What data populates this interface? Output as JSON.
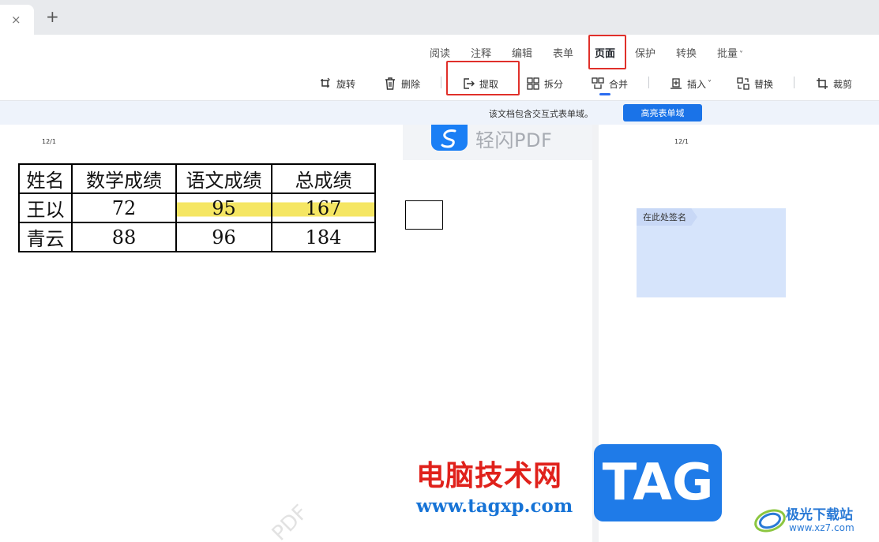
{
  "tabbar": {
    "close_glyph": "×",
    "new_tab_glyph": "+"
  },
  "menu": {
    "tabs": [
      "阅读",
      "注释",
      "编辑",
      "表单",
      "页面",
      "保护",
      "转换",
      "批量"
    ],
    "active": "页面",
    "batch_caret": "˅"
  },
  "toolbar": {
    "rotate": "旋转",
    "delete": "删除",
    "extract": "提取",
    "split": "拆分",
    "merge": "合并",
    "insert": "插入",
    "insert_caret": "˅",
    "replace": "替换",
    "crop": "裁剪"
  },
  "notice": {
    "text": "该文档包含交互式表单域。",
    "button": "高亮表单域"
  },
  "document": {
    "page_label_left": "12/1",
    "page_label_right": "12/1",
    "logo_text": "轻闪PDF",
    "table": {
      "headers": [
        "姓名",
        "数学成绩",
        "语文成绩",
        "总成绩"
      ],
      "rows": [
        [
          "王以",
          "72",
          "95",
          "167"
        ],
        [
          "青云",
          "88",
          "96",
          "184"
        ]
      ]
    },
    "signature_tag": "在此处签名",
    "diagonal_watermark": "PDF"
  },
  "watermark": {
    "title": "电脑技术网",
    "url": "www.tagxp.com",
    "tag": "TAG",
    "site_name": "极光下载站",
    "site_url": "www.xz7.com"
  },
  "colors": {
    "accent": "#1a73e8",
    "highlight_box": "#e0302a",
    "text_highlight": "#f5e663",
    "signature_field": "#d6e4fb"
  }
}
